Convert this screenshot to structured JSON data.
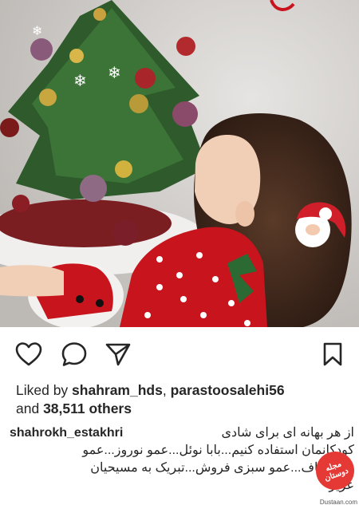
{
  "post": {
    "image_alt": "girl-looking-at-christmas-tree-photo"
  },
  "actions": {
    "like_icon": "heart-icon",
    "comment_icon": "comment-icon",
    "share_icon": "share-icon",
    "save_icon": "bookmark-icon"
  },
  "likes": {
    "prefix": "Liked by ",
    "user1": "shahram_hds",
    "separator": ", ",
    "user2": "parastoosalehi56",
    "and_text": "and ",
    "count": "38,511 others"
  },
  "caption": {
    "username": "shahrokh_estakhri",
    "line1": "از هر بهانه ای برای شادی",
    "line2": "کودکانمان استفاده کنیم...بابا نوئل...عمو نوروز...عمو",
    "line3": "زنجیر باف...عمو سبزی فروش...تبریک به مسیحیان",
    "line4": "عزیز"
  },
  "watermark": {
    "logo_text": "مجله دوستان",
    "site": "Dustaan.com"
  },
  "colors": {
    "text": "#262626",
    "watermark": "#e53935"
  }
}
